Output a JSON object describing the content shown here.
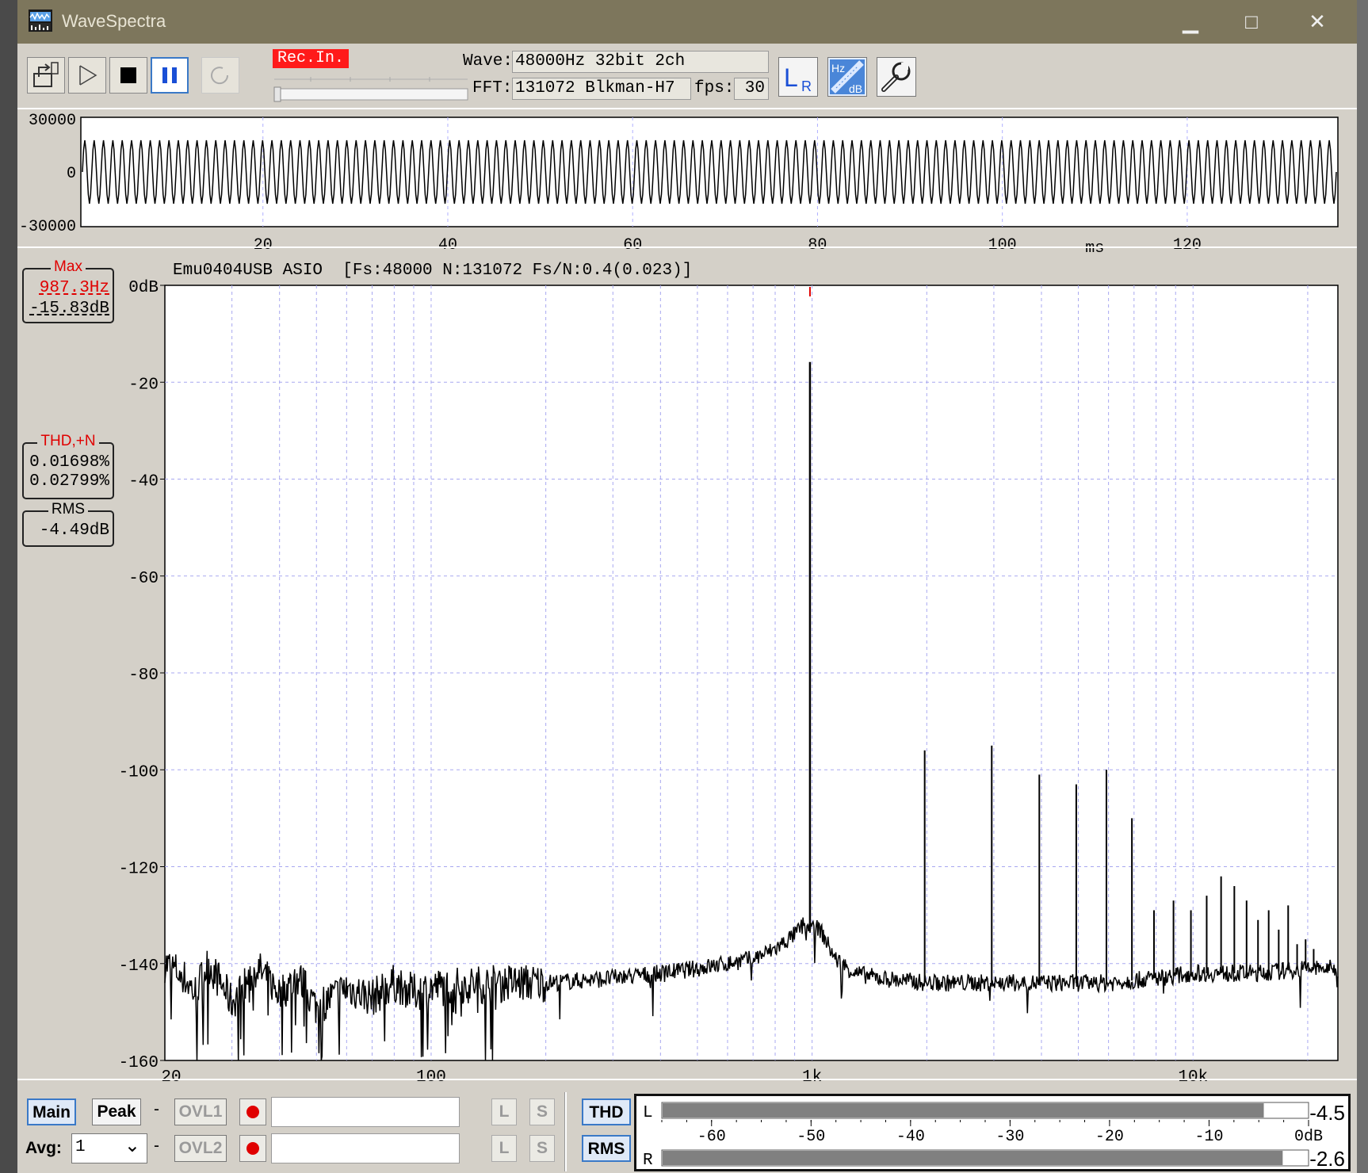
{
  "window": {
    "title": "WaveSpectra",
    "minimize_glyph": "▁",
    "maximize_glyph": "□",
    "close_glyph": "✕"
  },
  "toolbar": {
    "rec_badge": "Rec.In.",
    "wave_label": "Wave:",
    "wave_value": "48000Hz 32bit 2ch",
    "fft_label": "FFT:",
    "fft_value": "131072 Blkman-H7",
    "fps_label": "fps:",
    "fps_value": "30",
    "buttons": [
      "open-icon",
      "play-icon",
      "stop-icon",
      "pause-icon",
      "loop-icon",
      "lr-channel-icon",
      "hz-db-scale-icon",
      "settings-wrench-icon"
    ],
    "lr_icon_text": {
      "l": "L",
      "r": "R"
    },
    "hzdb_icon_text": {
      "hz": "Hz",
      "db": "dB"
    }
  },
  "waveform": {
    "y_ticks": [
      "30000",
      "0",
      "-30000"
    ],
    "x_ticks": [
      "20",
      "40",
      "60",
      "80",
      "100",
      "120"
    ],
    "x_unit": "ms"
  },
  "spectrum": {
    "header": "Emu0404USB ASIO  [Fs:48000 N:131072 Fs/N:0.4(0.023)]",
    "max_box": {
      "title": "Max",
      "freq": "987.3Hz",
      "level": "-15.83dB"
    },
    "thd_box": {
      "title": "THD,+N",
      "thd": "0.01698%",
      "thdn": "0.02799%"
    },
    "rms_box": {
      "title": "RMS",
      "value": "-4.49dB"
    }
  },
  "chart_data": {
    "type": "line",
    "title": "",
    "xlabel": "",
    "ylabel": "",
    "x_scale": "log",
    "xlim": [
      20,
      24000
    ],
    "ylim": [
      -160,
      0
    ],
    "y_ticks": [
      0,
      -20,
      -40,
      -60,
      -80,
      -100,
      -120,
      -140,
      -160
    ],
    "y_tick_labels": [
      "0dB",
      "-20",
      "-40",
      "-60",
      "-80",
      "-100",
      "-120",
      "-140",
      "-160"
    ],
    "x_tick_labels": [
      {
        "value": 20,
        "label": "20"
      },
      {
        "value": 100,
        "label": "100"
      },
      {
        "value": 1000,
        "label": "1k"
      },
      {
        "value": 10000,
        "label": "10k"
      }
    ],
    "grid": true,
    "noise_floor_points": [
      [
        20,
        -140
      ],
      [
        22,
        -142
      ],
      [
        24,
        -146
      ],
      [
        26,
        -140
      ],
      [
        28,
        -144
      ],
      [
        30,
        -148
      ],
      [
        35,
        -141
      ],
      [
        40,
        -146
      ],
      [
        45,
        -143
      ],
      [
        50,
        -149
      ],
      [
        60,
        -145
      ],
      [
        70,
        -147
      ],
      [
        80,
        -144
      ],
      [
        90,
        -146
      ],
      [
        100,
        -145
      ],
      [
        150,
        -144
      ],
      [
        200,
        -144
      ],
      [
        300,
        -143
      ],
      [
        400,
        -142
      ],
      [
        500,
        -141
      ],
      [
        600,
        -140
      ],
      [
        700,
        -139
      ],
      [
        800,
        -137
      ],
      [
        900,
        -134
      ],
      [
        950,
        -132
      ],
      [
        1050,
        -133
      ],
      [
        1150,
        -139
      ],
      [
        1300,
        -142
      ],
      [
        1500,
        -143
      ],
      [
        2000,
        -144
      ],
      [
        3000,
        -144
      ],
      [
        4000,
        -144
      ],
      [
        5000,
        -144
      ],
      [
        6000,
        -144
      ],
      [
        8000,
        -143
      ],
      [
        10000,
        -142
      ],
      [
        15000,
        -142
      ],
      [
        20000,
        -141
      ],
      [
        24000,
        -141
      ]
    ],
    "peaks": [
      {
        "freq": 987.3,
        "level": -15.83
      },
      {
        "freq": 1975,
        "level": -96
      },
      {
        "freq": 2962,
        "level": -95
      },
      {
        "freq": 3949,
        "level": -101
      },
      {
        "freq": 4937,
        "level": -103
      },
      {
        "freq": 5924,
        "level": -100
      },
      {
        "freq": 6911,
        "level": -110
      },
      {
        "freq": 7898,
        "level": -129
      },
      {
        "freq": 8886,
        "level": -127
      },
      {
        "freq": 9873,
        "level": -129
      },
      {
        "freq": 10860,
        "level": -126
      },
      {
        "freq": 11848,
        "level": -122
      },
      {
        "freq": 12835,
        "level": -124
      },
      {
        "freq": 13822,
        "level": -127
      },
      {
        "freq": 14810,
        "level": -131
      },
      {
        "freq": 15797,
        "level": -129
      },
      {
        "freq": 16784,
        "level": -133
      },
      {
        "freq": 17771,
        "level": -128
      },
      {
        "freq": 18759,
        "level": -136
      },
      {
        "freq": 19746,
        "level": -135
      },
      {
        "freq": 20733,
        "level": -137
      }
    ]
  },
  "bottom": {
    "main_btn": "Main",
    "peak_btn": "Peak",
    "dash1": "-",
    "dash2": "-",
    "dash3": "-",
    "ovl1": "OVL1",
    "ovl2": "OVL2",
    "l_btn": "L",
    "s_btn": "S",
    "thd_btn": "THD",
    "rms_btn": "RMS",
    "avg_label": "Avg:",
    "avg_value": "1",
    "avg_arrow": "⌄"
  },
  "level_meter": {
    "l_label": "L",
    "r_label": "R",
    "l_value": "-4.5",
    "r_value": "-2.6",
    "l_level_db": -4.5,
    "r_level_db": -2.6,
    "scale": [
      "-60",
      "-50",
      "-40",
      "-30",
      "-20",
      "-10",
      "0dB"
    ],
    "range_db": [
      -65,
      0
    ]
  }
}
